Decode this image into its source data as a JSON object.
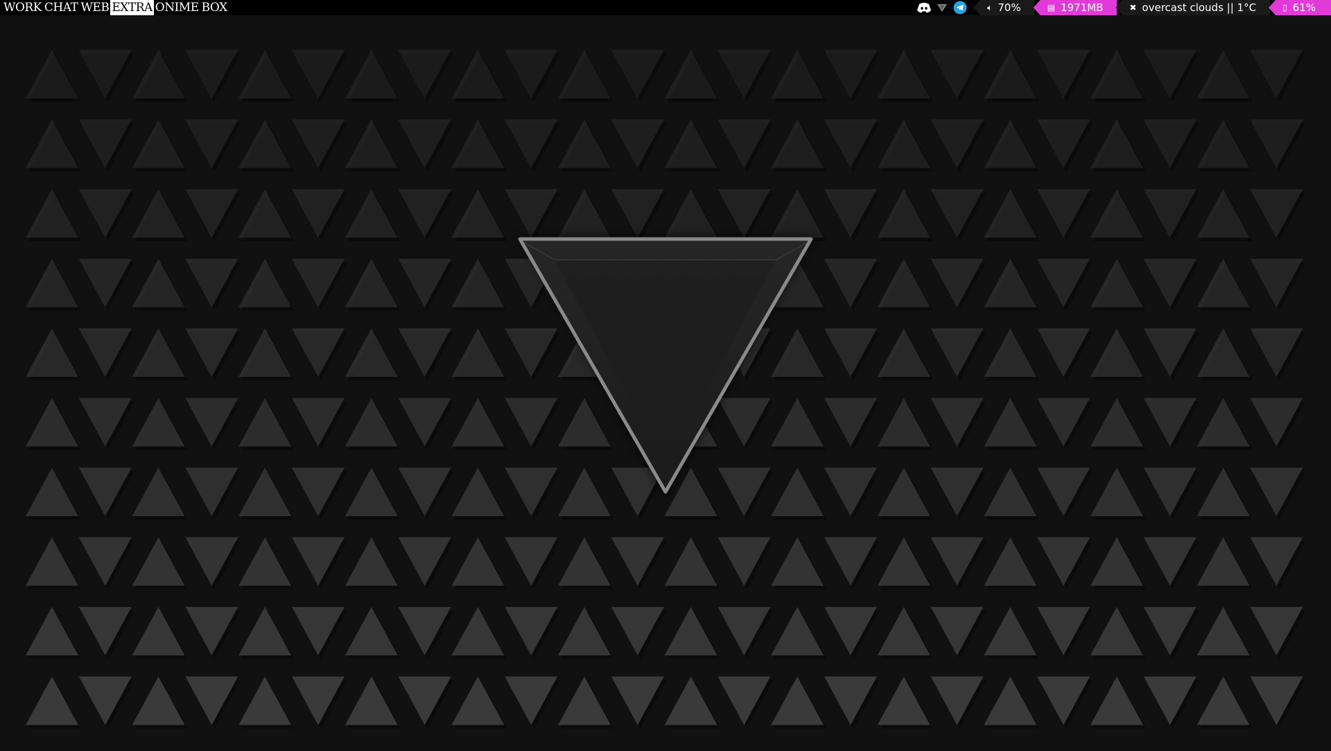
{
  "workspaces": [
    {
      "label": "WORK",
      "active": false
    },
    {
      "label": "CHAT",
      "active": false
    },
    {
      "label": "WEB",
      "active": false
    },
    {
      "label": "EXTRA",
      "active": true
    },
    {
      "label": "ONIME",
      "active": false
    },
    {
      "label": "BOX",
      "active": false
    }
  ],
  "tray": [
    {
      "name": "discord-icon"
    },
    {
      "name": "vpn-shield-icon"
    },
    {
      "name": "telegram-icon"
    }
  ],
  "status": {
    "volume": {
      "icon": "speaker-icon",
      "text": "70%"
    },
    "memory": {
      "icon": "memory-icon",
      "text": "1971MB"
    },
    "weather": {
      "icon": "cloud-icon",
      "text": "overcast clouds || 1°C"
    },
    "battery": {
      "icon": "battery-icon",
      "text": "61%"
    }
  },
  "colors": {
    "bar_bg": "#000000",
    "segment_dark": "#1a1a1a",
    "segment_accent": "#e23ad8",
    "wallpaper_bg": "#111111",
    "triangle_fill": "#3a3a3a",
    "logo_stroke": "#8a8a8a"
  }
}
